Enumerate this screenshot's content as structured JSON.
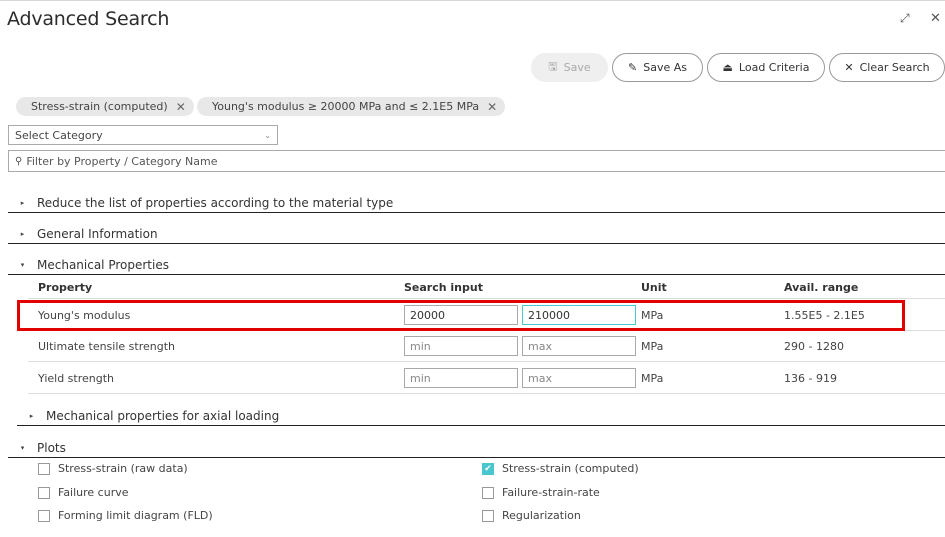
{
  "window": {
    "title": "Advanced Search",
    "expand_icon": "⤢",
    "close_icon": "✕"
  },
  "toolbar": {
    "save": {
      "label": "Save",
      "icon": "🖫",
      "disabled": true
    },
    "save_as": {
      "label": "Save As",
      "icon": "✎"
    },
    "load_criteria": {
      "label": "Load Criteria",
      "icon": "⏏"
    },
    "clear_search": {
      "label": "Clear Search",
      "icon": "✕"
    }
  },
  "chips": [
    {
      "label": "Stress-strain (computed)",
      "remove_icon": "✕"
    },
    {
      "label": "Young's modulus ≥ 20000 MPa and ≤ 2.1E5 MPa",
      "remove_icon": "✕"
    }
  ],
  "category_select": {
    "value": "Select Category",
    "chevron": "⌄"
  },
  "filter": {
    "placeholder": "Filter by Property / Category Name",
    "icon": "🔍"
  },
  "sections": [
    {
      "label": "Reduce the list of properties according to the material type",
      "expanded": false,
      "icon": "▸"
    },
    {
      "label": "General Information",
      "expanded": false,
      "icon": "▸"
    },
    {
      "label": "Mechanical Properties",
      "expanded": true,
      "icon": "▾"
    },
    {
      "label": "Mechanical properties for axial loading",
      "expanded": false,
      "icon": "▸"
    },
    {
      "label": "Plots",
      "expanded": true,
      "icon": "▾"
    }
  ],
  "table": {
    "headers": [
      "Property",
      "Search input",
      "Unit",
      "Avail. range"
    ],
    "rows": [
      {
        "property": "Young's modulus",
        "min": "20000",
        "max": "210000",
        "min_placeholder": "min",
        "max_placeholder": "max",
        "unit": "MPa",
        "range": "1.55E5 - 2.1E5"
      },
      {
        "property": "Ultimate tensile strength",
        "min": "",
        "max": "",
        "min_placeholder": "min",
        "max_placeholder": "max",
        "unit": "MPa",
        "range": "290 - 1280"
      },
      {
        "property": "Yield strength",
        "min": "",
        "max": "",
        "min_placeholder": "min",
        "max_placeholder": "max",
        "unit": "MPa",
        "range": "136 - 919"
      }
    ]
  },
  "plots": [
    {
      "label": "Stress-strain (raw data)",
      "checked": false
    },
    {
      "label": "Stress-strain (computed)",
      "checked": true
    },
    {
      "label": "Failure curve",
      "checked": false
    },
    {
      "label": "Failure-strain-rate",
      "checked": false
    },
    {
      "label": "Forming limit diagram (FLD)",
      "checked": false
    },
    {
      "label": "Regularization",
      "checked": false
    }
  ],
  "colors": {
    "accent": "#4ac6cf",
    "highlight": "#e30000"
  }
}
